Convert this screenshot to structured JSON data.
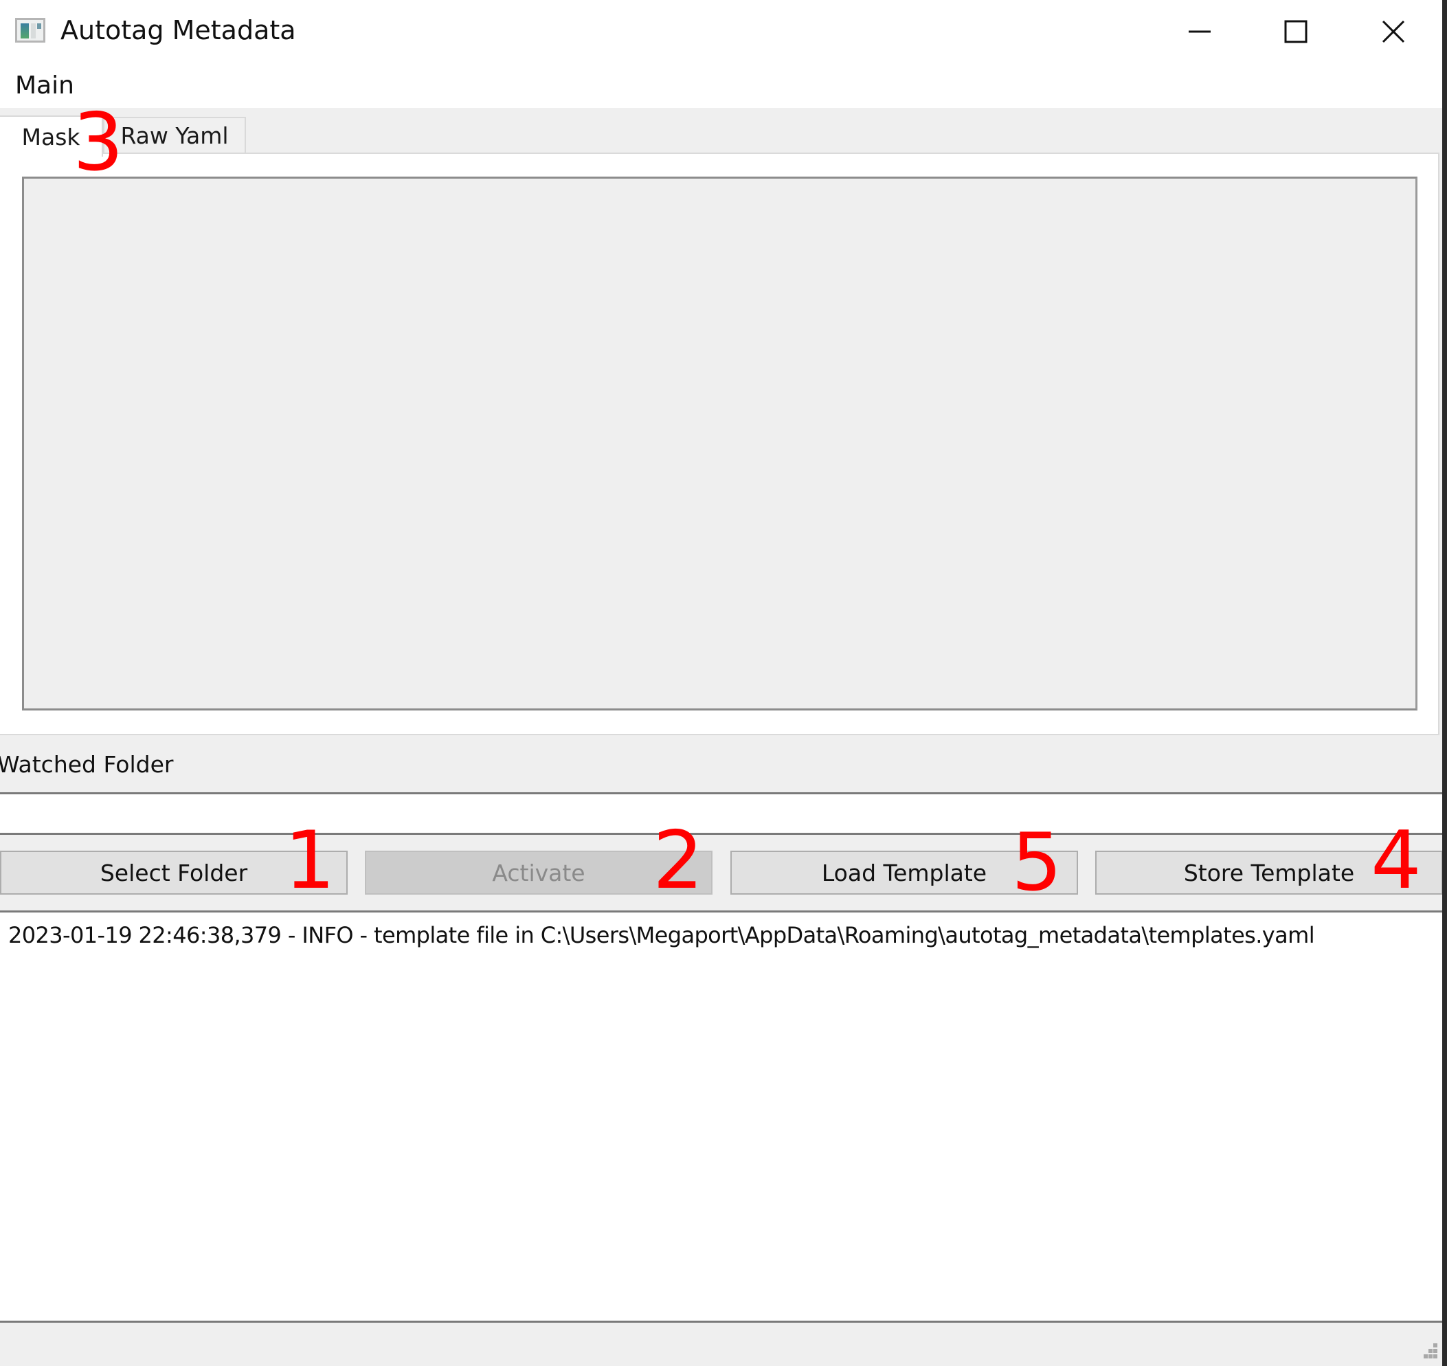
{
  "window": {
    "title": "Autotag Metadata",
    "icon": "app-window-icon",
    "controls": {
      "minimize_icon": "minimize-icon",
      "maximize_icon": "maximize-icon",
      "close_icon": "close-icon"
    }
  },
  "menubar": {
    "items": [
      {
        "label": "Main"
      }
    ]
  },
  "tabs": [
    {
      "label": "Mask",
      "selected": true
    },
    {
      "label": "Raw Yaml",
      "selected": false
    }
  ],
  "watched_folder": {
    "label": "Watched Folder",
    "value": "",
    "placeholder": ""
  },
  "buttons": {
    "select_folder": "Select Folder",
    "activate": "Activate",
    "activate_enabled": false,
    "load_template": "Load Template",
    "store_template": "Store Template"
  },
  "log": {
    "lines": [
      "2023-01-19 22:46:38,379 - INFO - template file in C:\\Users\\Megaport\\AppData\\Roaming\\autotag_metadata\\templates.yaml"
    ]
  },
  "annotations": {
    "select_folder": "1",
    "activate": "2",
    "tab_mask": "3",
    "store_template": "4",
    "load_template": "5",
    "color": "#ff0000"
  },
  "colors": {
    "window_bg": "#efefef",
    "button_bg": "#e1e1e1",
    "button_disabled_bg": "#cccccc",
    "annotation": "#ff0000"
  }
}
